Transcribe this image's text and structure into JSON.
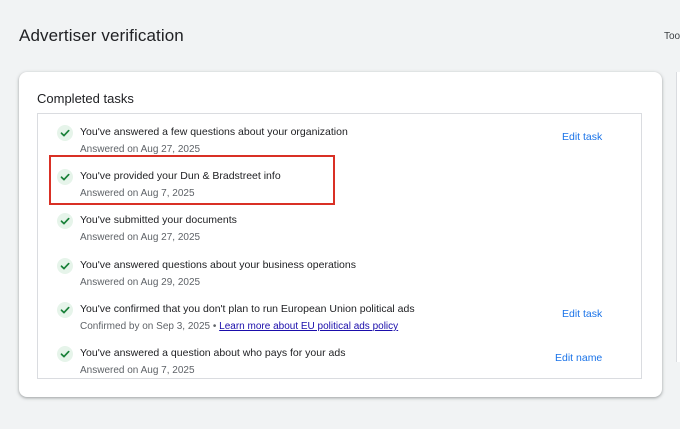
{
  "page": {
    "title": "Advertiser verification",
    "right_cut_text": "Too"
  },
  "card": {
    "title": "Completed tasks"
  },
  "tasks": [
    {
      "title": "You've answered a few questions about your organization",
      "sub": "Answered on Aug 27, 2025",
      "action": "Edit task"
    },
    {
      "title": "You've provided your Dun & Bradstreet info",
      "sub": "Answered on Aug 7, 2025",
      "action": ""
    },
    {
      "title": "You've submitted your documents",
      "sub": "Answered on Aug 27, 2025",
      "action": ""
    },
    {
      "title": "You've answered questions about your business operations",
      "sub": "Answered on Aug 29, 2025",
      "action": ""
    },
    {
      "title": "You've confirmed that you don't plan to run European Union political ads",
      "sub": "Confirmed by on Sep 3, 2025",
      "sub_separator": "•",
      "sub_link": "Learn more about EU political ads policy",
      "action": "Edit task"
    },
    {
      "title": "You've answered a question about who pays for your ads",
      "sub": "Answered on Aug 7, 2025",
      "action": "Edit name"
    }
  ],
  "colors": {
    "accent": "#1a73e8",
    "check": "#188038",
    "highlight": "#d93025",
    "link": "#1a0dab"
  },
  "icons": {
    "task_status": "check-icon"
  }
}
